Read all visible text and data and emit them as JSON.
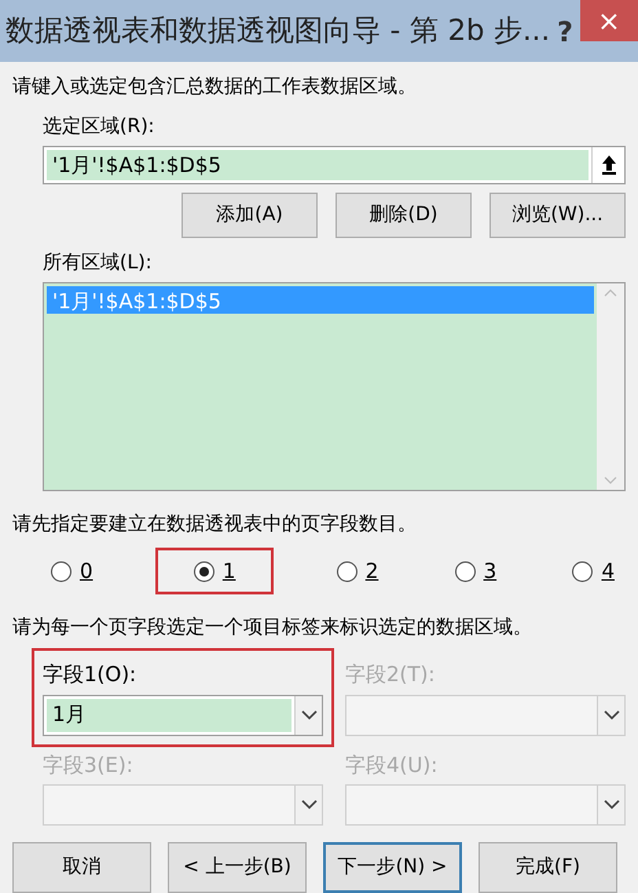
{
  "window": {
    "title": "数据透视表和数据透视图向导 - 第 2b 步...",
    "help": "?",
    "close": "×"
  },
  "range_prompt": "请键入或选定包含汇总数据的工作表数据区域。",
  "range": {
    "label": "选定区域(R):",
    "value": "'1月'!$A$1:$D$5"
  },
  "range_buttons": [
    "添加(A)",
    "删除(D)",
    "浏览(W)..."
  ],
  "all_ranges": {
    "label": "所有区域(L):",
    "items": [
      {
        "text": "'1月'!$A$1:$D$5",
        "selected": true
      }
    ]
  },
  "page_count_prompt": "请先指定要建立在数据透视表中的页字段数目。",
  "page_counts": [
    {
      "label": "0",
      "selected": false,
      "highlight": false
    },
    {
      "label": "1",
      "selected": true,
      "highlight": true
    },
    {
      "label": "2",
      "selected": false,
      "highlight": false
    },
    {
      "label": "3",
      "selected": false,
      "highlight": false
    },
    {
      "label": "4",
      "selected": false,
      "highlight": false
    }
  ],
  "fields_prompt": "请为每一个页字段选定一个项目标签来标识选定的数据区域。",
  "fields": [
    {
      "label": "字段1(O):",
      "value": "1月",
      "disabled": false,
      "highlight": true
    },
    {
      "label": "字段2(T):",
      "disabled": true,
      "highlight": false
    },
    {
      "label": "字段3(E):",
      "disabled": true,
      "highlight": false
    },
    {
      "label": "字段4(U):",
      "disabled": true,
      "highlight": false
    }
  ],
  "buttons": [
    {
      "label": "取消",
      "default": false
    },
    {
      "label": "< 上一步(B)",
      "default": false
    },
    {
      "label": "下一步(N) >",
      "default": true
    },
    {
      "label": "完成(F)",
      "default": false
    }
  ]
}
